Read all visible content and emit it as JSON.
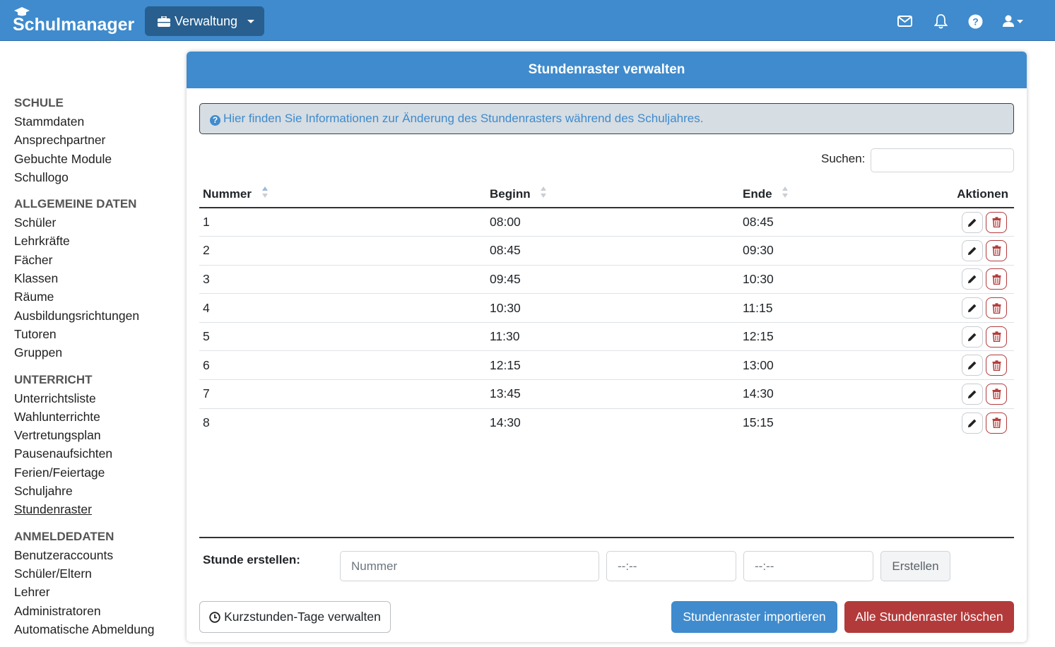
{
  "navbar": {
    "brand": "Schulmanager",
    "menu_label": "Verwaltung",
    "icons": [
      "mail-icon",
      "bell-icon",
      "help-icon",
      "user-icon"
    ]
  },
  "sidebar": {
    "sections": [
      {
        "title": "SCHULE",
        "items": [
          "Stammdaten",
          "Ansprechpartner",
          "Gebuchte Module",
          "Schullogo"
        ]
      },
      {
        "title": "ALLGEMEINE DATEN",
        "items": [
          "Schüler",
          "Lehrkräfte",
          "Fächer",
          "Klassen",
          "Räume",
          "Ausbildungsrichtungen",
          "Tutoren",
          "Gruppen"
        ]
      },
      {
        "title": "UNTERRICHT",
        "items": [
          "Unterrichtsliste",
          "Wahlunterrichte",
          "Vertretungsplan",
          "Pausenaufsichten",
          "Ferien/Feiertage",
          "Schuljahre",
          "Stundenraster"
        ]
      },
      {
        "title": "ANMELDEDATEN",
        "items": [
          "Benutzeraccounts",
          "Schüler/Eltern",
          "Lehrer",
          "Administratoren",
          "Automatische Abmeldung"
        ]
      }
    ],
    "active_item": "Stundenraster"
  },
  "main": {
    "title": "Stundenraster verwalten",
    "info_text": "Hier finden Sie Informationen zur Änderung des Stundenrasters während des Schuljahres.",
    "search_label": "Suchen:",
    "search_value": "",
    "table": {
      "columns": [
        "Nummer",
        "Beginn",
        "Ende",
        "Aktionen"
      ],
      "rows": [
        [
          "1",
          "08:00",
          "08:45"
        ],
        [
          "2",
          "08:45",
          "09:30"
        ],
        [
          "3",
          "09:45",
          "10:30"
        ],
        [
          "4",
          "10:30",
          "11:15"
        ],
        [
          "5",
          "11:30",
          "12:15"
        ],
        [
          "6",
          "12:15",
          "13:00"
        ],
        [
          "7",
          "13:45",
          "14:30"
        ],
        [
          "8",
          "14:30",
          "15:15"
        ]
      ]
    },
    "create": {
      "label": "Stunde erstellen:",
      "number_placeholder": "Nummer",
      "begin_placeholder": "--:--",
      "end_placeholder": "--:--",
      "button": "Erstellen"
    },
    "buttons": {
      "kurzstunden": "Kurzstunden-Tage verwalten",
      "import": "Stundenraster importieren",
      "delete_all": "Alle Stundenraster löschen"
    }
  },
  "colors": {
    "primary": "#3f8bcd",
    "navbar_button": "#285f8e",
    "danger": "#b33a3a",
    "info_bg": "#d6dde3"
  }
}
